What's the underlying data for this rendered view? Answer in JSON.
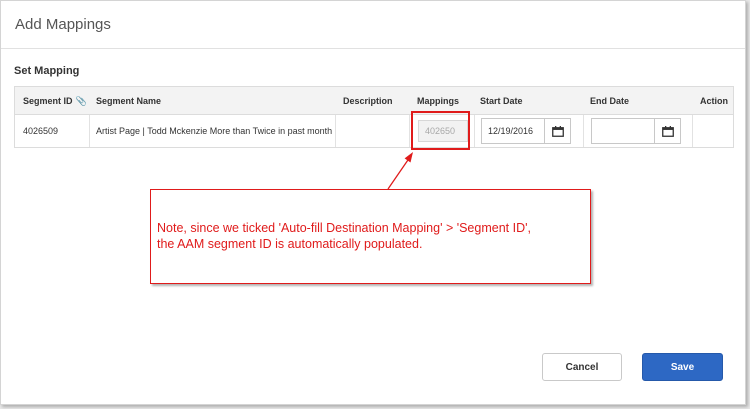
{
  "dialog": {
    "title": "Add Mappings"
  },
  "section": {
    "title": "Set Mapping"
  },
  "table": {
    "headers": {
      "segment_id": "Segment ID",
      "segment_name": "Segment Name",
      "description": "Description",
      "mappings": "Mappings",
      "start_date": "Start Date",
      "end_date": "End Date",
      "action": "Action"
    },
    "row": {
      "segment_id": "4026509",
      "segment_name": "Artist Page | Todd Mckenzie More than Twice in past month",
      "description": "",
      "mapping_value": "402650",
      "start_date": "12/19/2016",
      "end_date": ""
    }
  },
  "icons": {
    "header_clip": "paperclip-icon",
    "calendar": "calendar-icon"
  },
  "annotation": {
    "line1": "Note, since we ticked 'Auto-fill Destination Mapping' > 'Segment ID',",
    "line2": "the AAM segment ID is automatically populated.",
    "color": "#e01b1b"
  },
  "buttons": {
    "cancel": "Cancel",
    "save": "Save"
  },
  "colors": {
    "primary": "#2d68c4"
  }
}
